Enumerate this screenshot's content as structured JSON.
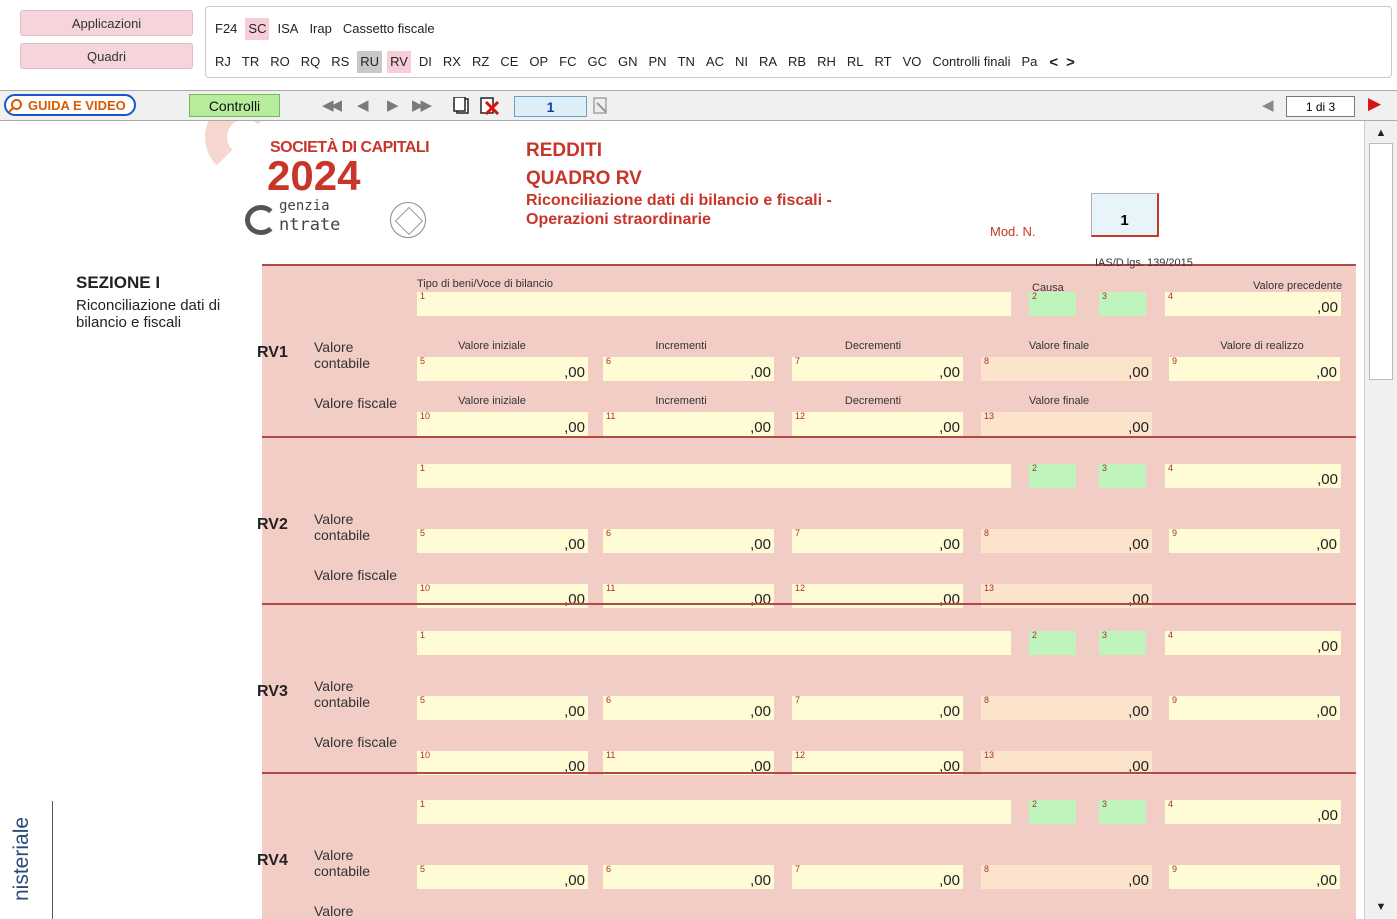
{
  "nav": {
    "applicazioni_label": "Applicazioni",
    "quadri_label": "Quadri",
    "app_tabs": [
      "F24",
      "SC",
      "ISA",
      "Irap",
      "Cassetto fiscale"
    ],
    "quadri_tabs": [
      "RJ",
      "TR",
      "RO",
      "RQ",
      "RS",
      "RU",
      "RV",
      "DI",
      "RX",
      "RZ",
      "CE",
      "OP",
      "FC",
      "GC",
      "GN",
      "PN",
      "TN",
      "AC",
      "NI",
      "RA",
      "RB",
      "RH",
      "RL",
      "RT",
      "VO",
      "Controlli finali",
      "Pa"
    ],
    "prev_symbol": "<",
    "next_symbol": ">"
  },
  "toolbar": {
    "guida_label": "GUIDA E VIDEO",
    "controlli_label": "Controlli",
    "page_value": "1",
    "page_count": "1 di 3"
  },
  "header": {
    "societa": "SOCIETÀ DI CAPITALI",
    "year": "2024",
    "agenzia_line1": "genzia",
    "agenzia_line2": "ntrate",
    "title": "REDDITI",
    "quadro": "QUADRO RV",
    "subtitle_line1": "Riconciliazione dati di bilancio e fiscali -",
    "subtitle_line2": "Operazioni straordinarie",
    "mod_label": "Mod. N.",
    "mod_value": "1"
  },
  "section": {
    "title": "SEZIONE I",
    "description": "Riconciliazione dati di bilancio e fiscali"
  },
  "side_text": "nisteriale",
  "column_headers": {
    "tipo_beni": "Tipo di beni/Voce di bilancio",
    "causa": "Causa",
    "ias": "IAS/D.lgs. 139/2015",
    "valore_precedente": "Valore precedente",
    "valore_iniziale": "Valore iniziale",
    "incrementi": "Incrementi",
    "decrementi": "Decrementi",
    "valore_finale": "Valore finale",
    "valore_realizzo": "Valore di realizzo"
  },
  "rows": [
    {
      "code": "RV1",
      "contabile": "Valore contabile",
      "fiscale": "Valore fiscale"
    },
    {
      "code": "RV2",
      "contabile": "Valore contabile",
      "fiscale": "Valore fiscale"
    },
    {
      "code": "RV3",
      "contabile": "Valore contabile",
      "fiscale": "Valore fiscale"
    },
    {
      "code": "RV4",
      "contabile": "Valore contabile",
      "fiscale": "Valore"
    }
  ],
  "decimal_suffix": ",00",
  "colors": {
    "accent_red": "#c8362a",
    "form_background": "#f2cdc6",
    "field_yellow": "#fefbd5",
    "field_green": "#bff4bd",
    "field_orange": "#fbe3cc",
    "nav_pink": "#f6d4dc",
    "controlli_green": "#b6ec9b"
  },
  "icons": [
    "magnifier-icon",
    "first-page-icon",
    "prev-page-icon",
    "next-page-icon",
    "last-page-icon",
    "new-page-icon",
    "delete-page-icon",
    "print-icon",
    "scroll-left-icon",
    "scroll-right-icon",
    "scroll-up-icon",
    "scroll-down-icon"
  ]
}
